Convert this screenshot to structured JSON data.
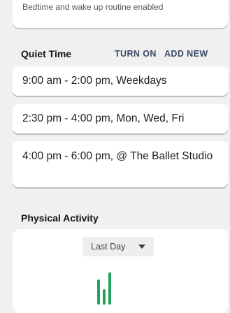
{
  "routine_card": {
    "subtext": "Bedtime and wake up routine enabled"
  },
  "quiet_time": {
    "title": "Quiet Time",
    "turn_on_label": "TURN ON",
    "add_new_label": "ADD NEW",
    "schedules": [
      {
        "text": "9:00 am - 2:00 pm, Weekdays"
      },
      {
        "text": "2:30 pm - 4:00 pm, Mon, Wed, Fri"
      },
      {
        "text": "4:00 pm - 6:00 pm, @ The Ballet Studio"
      }
    ]
  },
  "physical_activity": {
    "title": "Physical Activity",
    "range_selected": "Last Day",
    "icon": "activity-bars-icon",
    "accent_color": "#1fa35a"
  }
}
